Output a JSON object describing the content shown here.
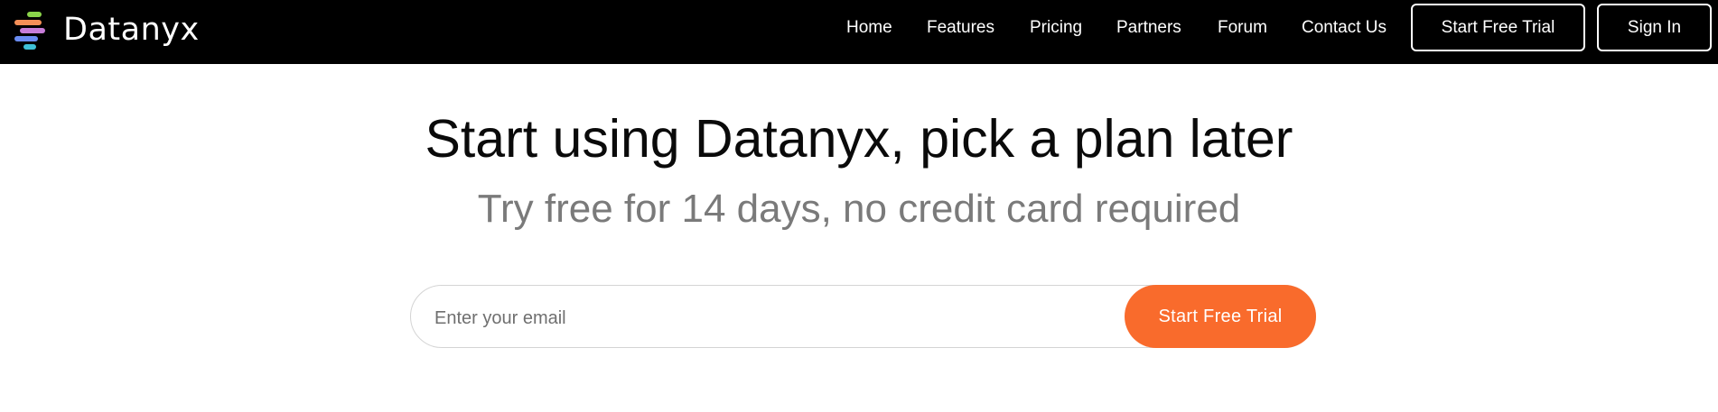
{
  "brand": {
    "name": "Datanyx",
    "logo_colors": [
      "#8bd44a",
      "#f58f57",
      "#c77dd9",
      "#6a8cf2",
      "#3fc1d8"
    ]
  },
  "nav": {
    "links": [
      "Home",
      "Features",
      "Pricing",
      "Partners",
      "Forum",
      "Contact Us"
    ],
    "trial_button": "Start Free Trial",
    "signin_button": "Sign In"
  },
  "hero": {
    "title": "Start using Datanyx, pick a plan later",
    "subtitle": "Try free for 14 days, no credit card required"
  },
  "signup": {
    "email_placeholder": "Enter your email",
    "email_value": "",
    "submit_label": "Start Free Trial",
    "accent_color": "#f96b2c"
  }
}
